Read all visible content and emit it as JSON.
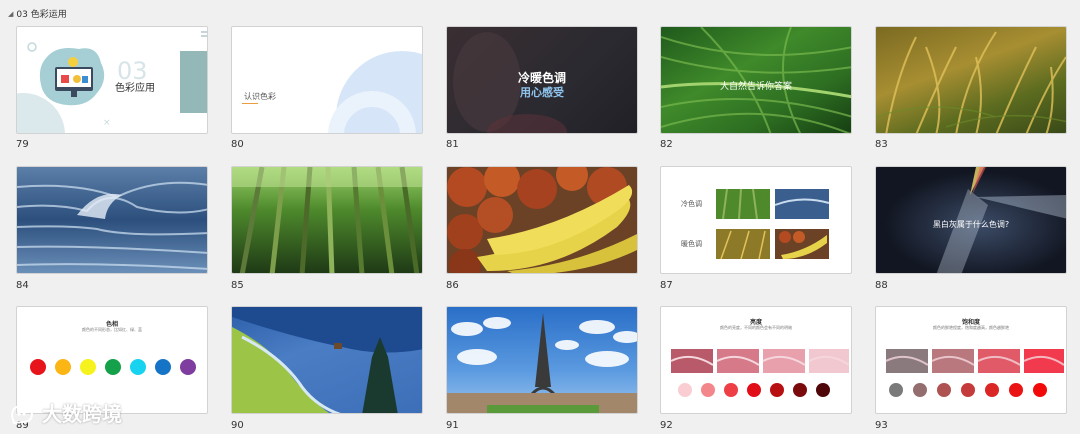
{
  "section": {
    "title": "03 色彩运用"
  },
  "slides": {
    "s79": {
      "num": "79",
      "big": "03",
      "title": "色彩应用"
    },
    "s80": {
      "num": "80",
      "title": "认识色彩"
    },
    "s81": {
      "num": "81",
      "line1": "冷暖色调",
      "line2": "用心感受"
    },
    "s82": {
      "num": "82",
      "title": "大自然告诉你答案"
    },
    "s83": {
      "num": "83"
    },
    "s84": {
      "num": "84"
    },
    "s85": {
      "num": "85"
    },
    "s86": {
      "num": "86"
    },
    "s87": {
      "num": "87",
      "cool": "冷色调",
      "warm": "暖色调"
    },
    "s88": {
      "num": "88",
      "title": "黑白灰属于什么色调?"
    },
    "s89": {
      "num": "89",
      "title": "色相",
      "sub": "颜色的不同形态，比如红、绿、蓝"
    },
    "s90": {
      "num": "90"
    },
    "s91": {
      "num": "91"
    },
    "s92": {
      "num": "92",
      "title": "亮度",
      "sub": "颜色的亮度，不同的颜色会有不同的明暗"
    },
    "s93": {
      "num": "93",
      "title": "饱和度",
      "sub": "颜色的鲜艳程度，饱和度越高，颜色越鲜艳"
    }
  },
  "colors": {
    "hue": [
      "#e8141b",
      "#fbb515",
      "#f6f21d",
      "#14a14a",
      "#18d3ef",
      "#1674c7",
      "#7e3d9f"
    ],
    "lightness": [
      "#f9cdd2",
      "#f3868b",
      "#ef3f46",
      "#e10d17",
      "#b80f13",
      "#7a0a0c",
      "#4f0608"
    ],
    "saturation": [
      "#7a7a7a",
      "#946e6e",
      "#ae5252",
      "#c53b3b",
      "#db2626",
      "#eb1414",
      "#f20a0a"
    ]
  },
  "watermark": {
    "text": "大数跨境"
  }
}
